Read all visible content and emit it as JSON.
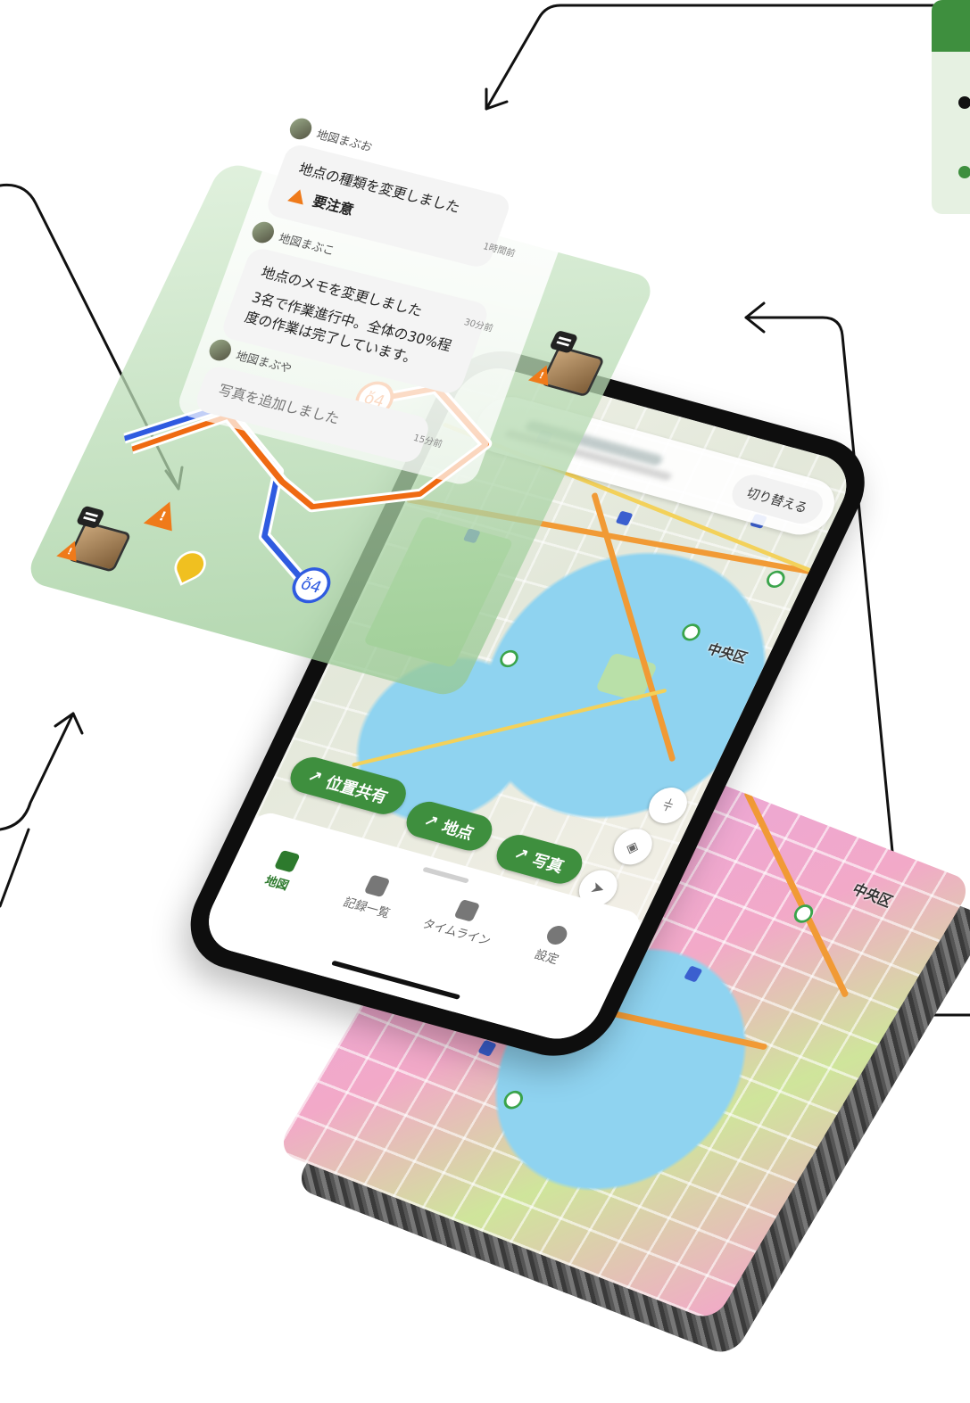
{
  "chat": {
    "messages": [
      {
        "user": "地図まぶお",
        "text": "地点の種類を変更しました",
        "tag": "要注意",
        "time": "1時間前"
      },
      {
        "user": "地図まぶこ",
        "text": "地点のメモを変更しました",
        "detail": "3名で作業進行中。全体の30%程度の作業は完了しています。",
        "time": "30分前"
      },
      {
        "user": "地図まぶや",
        "text": "写真を追加しました",
        "time": "15分前"
      }
    ]
  },
  "map": {
    "switch_label": "切り替える",
    "area_label": "中央区",
    "area_label_lower": "中央区"
  },
  "chips": [
    {
      "label": "位置共有"
    },
    {
      "label": "地点"
    },
    {
      "label": "写真"
    }
  ],
  "tabs": [
    {
      "label": "地図",
      "icon": "map-icon",
      "active": true
    },
    {
      "label": "記録一覧",
      "icon": "record-list-icon",
      "active": false
    },
    {
      "label": "タイムライン",
      "icon": "timeline-icon",
      "active": false
    },
    {
      "label": "設定",
      "icon": "gear-icon",
      "active": false
    }
  ],
  "colors": {
    "accent": "#3e8f3e",
    "route_orange": "#ef6a12",
    "route_blue": "#2f5be0",
    "warning": "#ef7a1a",
    "marker_yellow": "#f0c020"
  }
}
